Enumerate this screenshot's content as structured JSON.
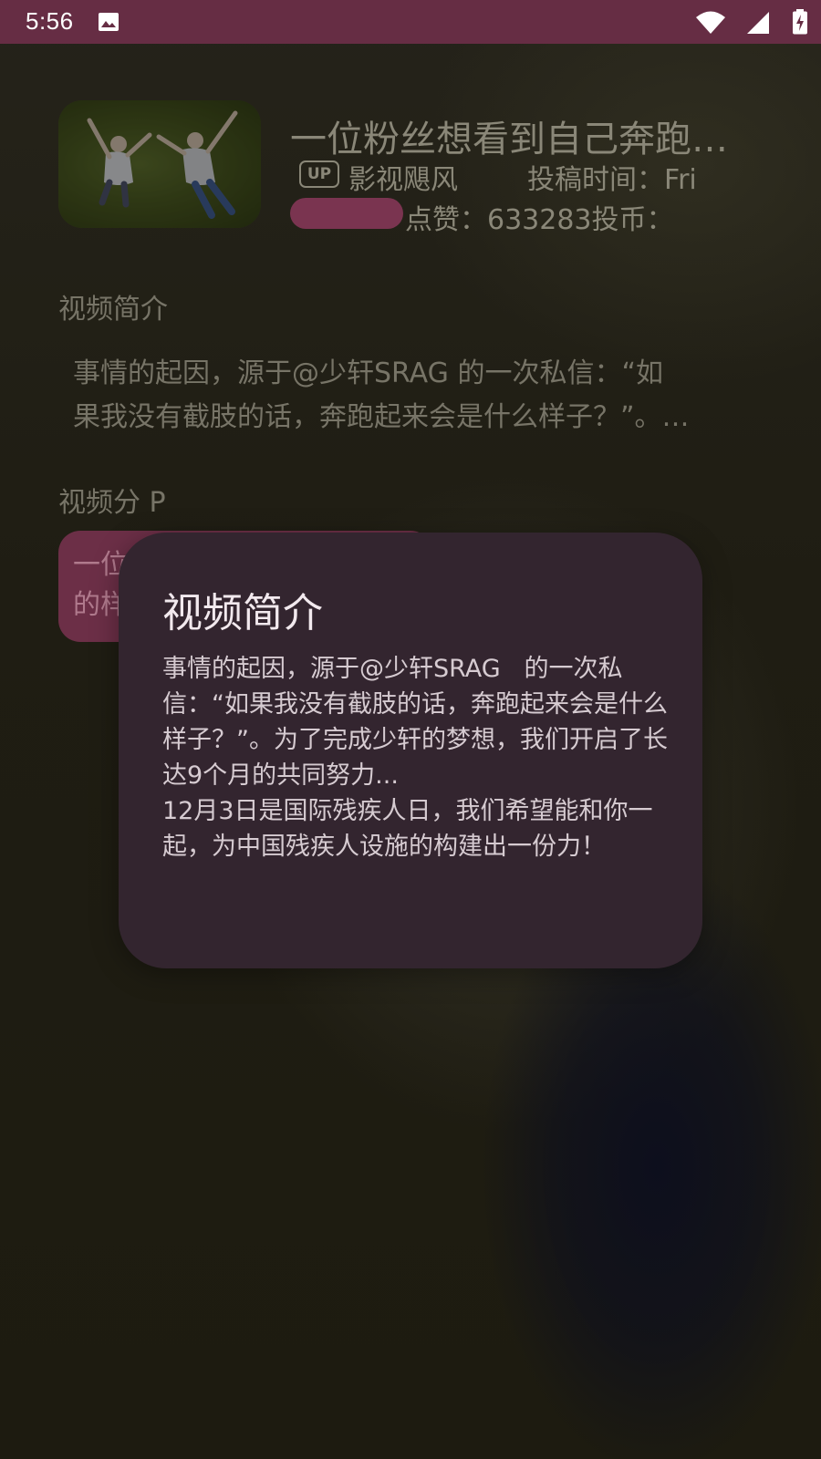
{
  "status_bar": {
    "time": "5:56",
    "background": "#662d44",
    "icons": [
      "image-icon",
      "wifi-icon",
      "signal-icon",
      "battery-charging-icon"
    ]
  },
  "video": {
    "title": "一位粉丝想看到自己奔跑…",
    "up_badge": "UP",
    "uploader": "影视飓风",
    "upload_time": "投稿时间：Fri",
    "stats": "点赞：633283投币：",
    "thumbnail": "two-people-lying-on-grass"
  },
  "sections": {
    "intro_heading": "视频简介",
    "intro_preview_line1": "事情的起因，源于@少轩SRAG   的一次私信：“如",
    "intro_preview_line2": "果我没有截肢的话，奔跑起来会是什么样子？”。…",
    "parts_heading": "视频分 P",
    "part_card_line1": "一位",
    "part_card_line2": "的样"
  },
  "dialog": {
    "title": "视频简介",
    "body": "事情的起因，源于@少轩SRAG   的一次私信：“如果我没有截肢的话，奔跑起来会是什么样子？”。为了完成少轩的梦想，我们开启了长达9个月的共同努力...\n12月3日是国际残疾人日，我们希望能和你一起，为中国残疾人设施的构建出一份力！",
    "background": "#33252f"
  }
}
